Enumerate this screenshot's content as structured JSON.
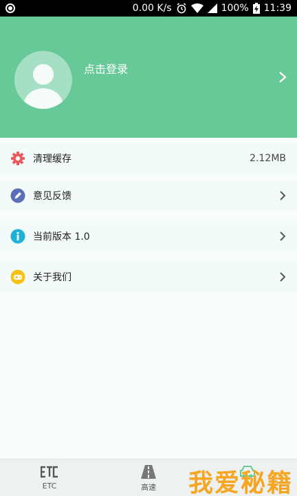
{
  "status_bar": {
    "speed": "0.00 K/s",
    "battery": "100%",
    "time": "11:39"
  },
  "header": {
    "login_label": "点击登录"
  },
  "menu": [
    {
      "label": "清理缓存",
      "value": "2.12MB",
      "icon": "gear-icon",
      "color": "#e9595d"
    },
    {
      "label": "意见反馈",
      "value": "",
      "icon": "pencil-icon",
      "color": "#5b6fb8"
    },
    {
      "label": "当前版本  1.0",
      "value": "",
      "icon": "info-icon",
      "color": "#1bb2d6"
    },
    {
      "label": "关于我们",
      "value": "",
      "icon": "gamepad-icon",
      "color": "#f4c316"
    }
  ],
  "bottom_nav": {
    "tabs": [
      {
        "label": "ETC",
        "icon": "etc-icon"
      },
      {
        "label": "高速",
        "icon": "highway-icon"
      }
    ]
  },
  "watermark": "我爱秘籍",
  "colors": {
    "header_bg": "#68c998",
    "page_bg": "#f7fdfd",
    "row_bg": "#f3fafa"
  }
}
